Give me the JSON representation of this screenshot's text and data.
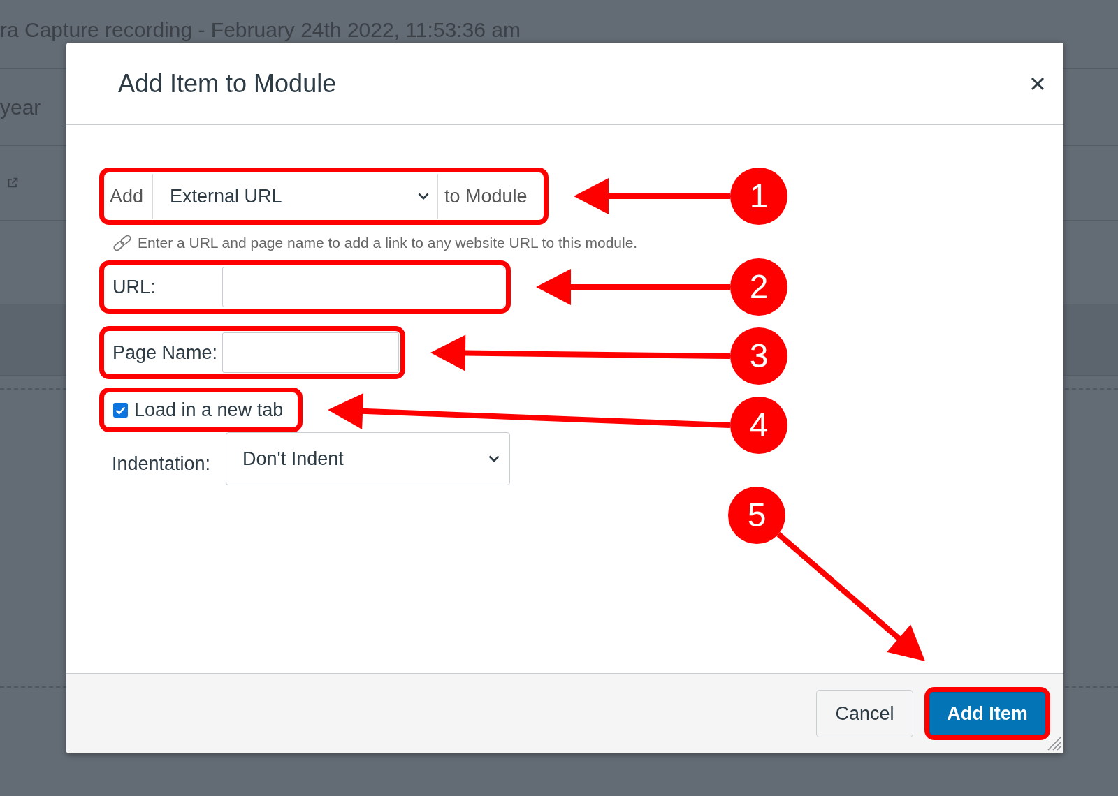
{
  "page": {
    "heading": "ra Capture recording - February 24th 2022, 11:53:36 am",
    "row_label": "year"
  },
  "dialog": {
    "title": "Add Item to Module",
    "item_type": {
      "prefix": "Add",
      "value": "External URL",
      "suffix": "to Module",
      "callout": "1"
    },
    "help_text": "Enter a URL and page name to add a link to any website URL to this module.",
    "fields": [
      {
        "label": "URL:",
        "callout": "2"
      },
      {
        "label": "Page Name:",
        "callout": "3"
      }
    ],
    "new_tab": {
      "label": "Load in a new tab",
      "checked": true,
      "callout": "4"
    },
    "indentation": {
      "label": "Indentation:",
      "value": "Don't Indent"
    },
    "buttons": [
      {
        "label": "Cancel",
        "kind": "secondary"
      },
      {
        "label": "Add Item",
        "kind": "primary",
        "callout": "5"
      }
    ]
  }
}
